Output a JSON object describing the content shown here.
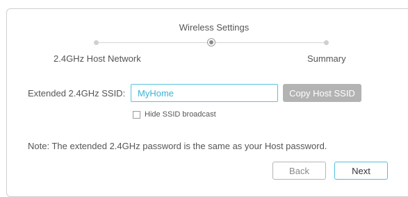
{
  "stepper": {
    "title": "Wireless Settings",
    "steps": [
      {
        "label": "2.4GHz Host Network",
        "state": "done"
      },
      {
        "label": "",
        "state": "current"
      },
      {
        "label": "Summary",
        "state": "pending"
      }
    ]
  },
  "form": {
    "ssid_label": "Extended 2.4GHz SSID:",
    "ssid_value": "MyHome",
    "copy_button": "Copy Host SSID",
    "hide_ssid_label": "Hide SSID broadcast",
    "hide_ssid_checked": false
  },
  "note": "Note: The extended 2.4GHz password is the same as your Host password.",
  "actions": {
    "back": "Back",
    "next": "Next"
  },
  "colors": {
    "accent": "#4cc0de",
    "input_text": "#39b3d6",
    "disabled_button": "#b3b3b3",
    "border": "#cfcfcf"
  }
}
